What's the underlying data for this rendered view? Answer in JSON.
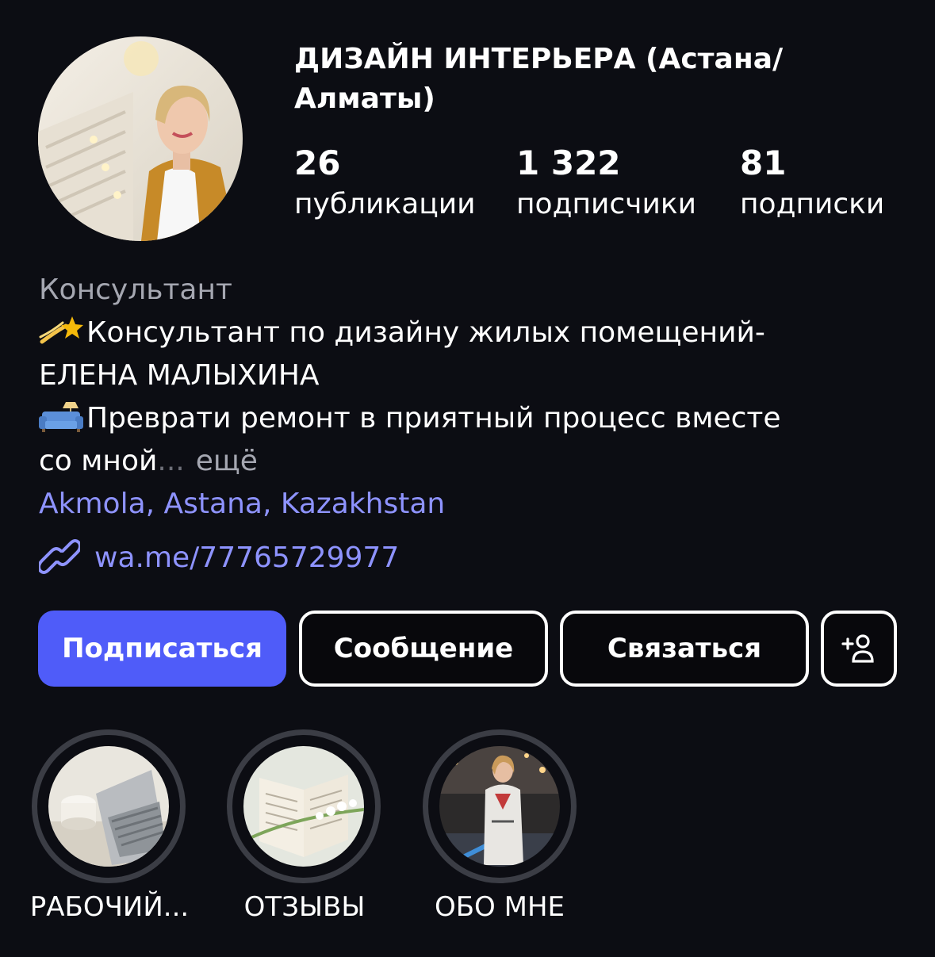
{
  "profile": {
    "name": "ДИЗАЙН ИНТЕРЬЕРА (Астана/ Алматы)",
    "avatar_alt": "profile-photo"
  },
  "stats": {
    "posts": {
      "value": "26",
      "label": "публикации"
    },
    "followers": {
      "value": "1 322",
      "label": "подписчики"
    },
    "following": {
      "value": "81",
      "label": "подписки"
    }
  },
  "bio": {
    "category": "Консультант",
    "line1": "Консультант по дизайну жилых помещений-",
    "line2": "ЕЛЕНА МАЛЫХИНА",
    "line3": "Преврати ремонт в приятный процесс вместе",
    "line4": "со мной",
    "ellipsis": "...",
    "more": "ещё",
    "location": "Akmola, Astana, Kazakhstan",
    "link": "wa.me/77765729977"
  },
  "buttons": {
    "follow": "Подписаться",
    "message": "Сообщение",
    "contact": "Связаться",
    "add_user_icon": "add-person-icon"
  },
  "highlights": [
    {
      "label": "РАБОЧИЙ..."
    },
    {
      "label": "ОТЗЫВЫ"
    },
    {
      "label": "ОБО МНЕ"
    }
  ],
  "colors": {
    "background": "#0c0d13",
    "accent": "#4f5cf9",
    "link": "#8e93ff",
    "muted": "#a5a7b1"
  }
}
